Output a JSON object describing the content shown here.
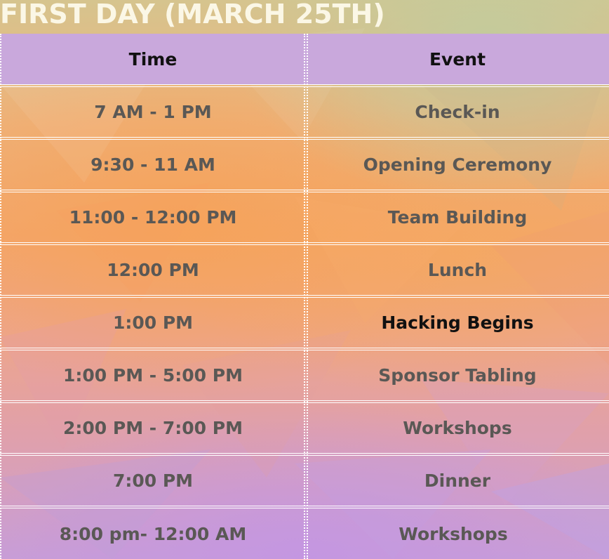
{
  "title": "FIRST DAY (MARCH 25TH)",
  "columns": {
    "time": "Time",
    "event": "Event"
  },
  "rows": [
    {
      "time": "7 AM - 1 PM",
      "event": "Check-in"
    },
    {
      "time": "9:30 - 11 AM",
      "event": "Opening Ceremony"
    },
    {
      "time": "11:00 - 12:00 PM",
      "event": "Team Building"
    },
    {
      "time": "12:00 PM",
      "event": "Lunch"
    },
    {
      "time": "1:00 PM",
      "event": "Hacking Begins"
    },
    {
      "time": "1:00 PM - 5:00 PM",
      "event": "Sponsor Tabling"
    },
    {
      "time": "2:00 PM - 7:00 PM",
      "event": "Workshops"
    },
    {
      "time": "7:00 PM",
      "event": "Dinner"
    },
    {
      "time": "8:00 pm- 12:00 AM",
      "event": "Workshops"
    }
  ],
  "colors": {
    "header_bg": "#c9a8dc",
    "title": "#fbf7e6",
    "text": "#5a5855",
    "highlight_text": "#111111"
  }
}
